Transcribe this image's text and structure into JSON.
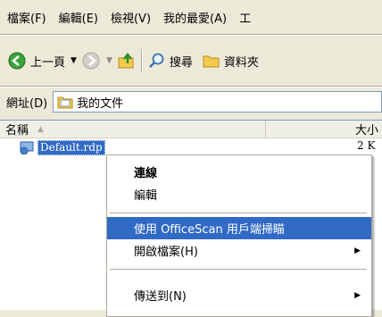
{
  "menubar": {
    "items": [
      "檔案(F)",
      "編輯(E)",
      "檢視(V)",
      "我的最愛(A)",
      "工"
    ]
  },
  "toolbar": {
    "back_label": "上一頁",
    "search_label": "搜尋",
    "folders_label": "資料夾"
  },
  "address": {
    "label": "網址(D)",
    "value": "我的文件"
  },
  "filelist": {
    "col_name": "名稱",
    "col_size": "大小",
    "files": [
      {
        "name": "Default.rdp",
        "size": "2 K"
      }
    ]
  },
  "context_menu": {
    "items": [
      {
        "label": "連線",
        "bold": true
      },
      {
        "label": "編輯"
      },
      {
        "label": "使用 OfficeScan 用戶端掃瞄",
        "highlighted": true
      },
      {
        "label": "開啟檔案(H)",
        "submenu": true
      },
      {
        "label": "傳送到(N)",
        "submenu": true
      }
    ]
  },
  "colors": {
    "accent": "#316ac5",
    "chrome": "#ece9d8"
  }
}
